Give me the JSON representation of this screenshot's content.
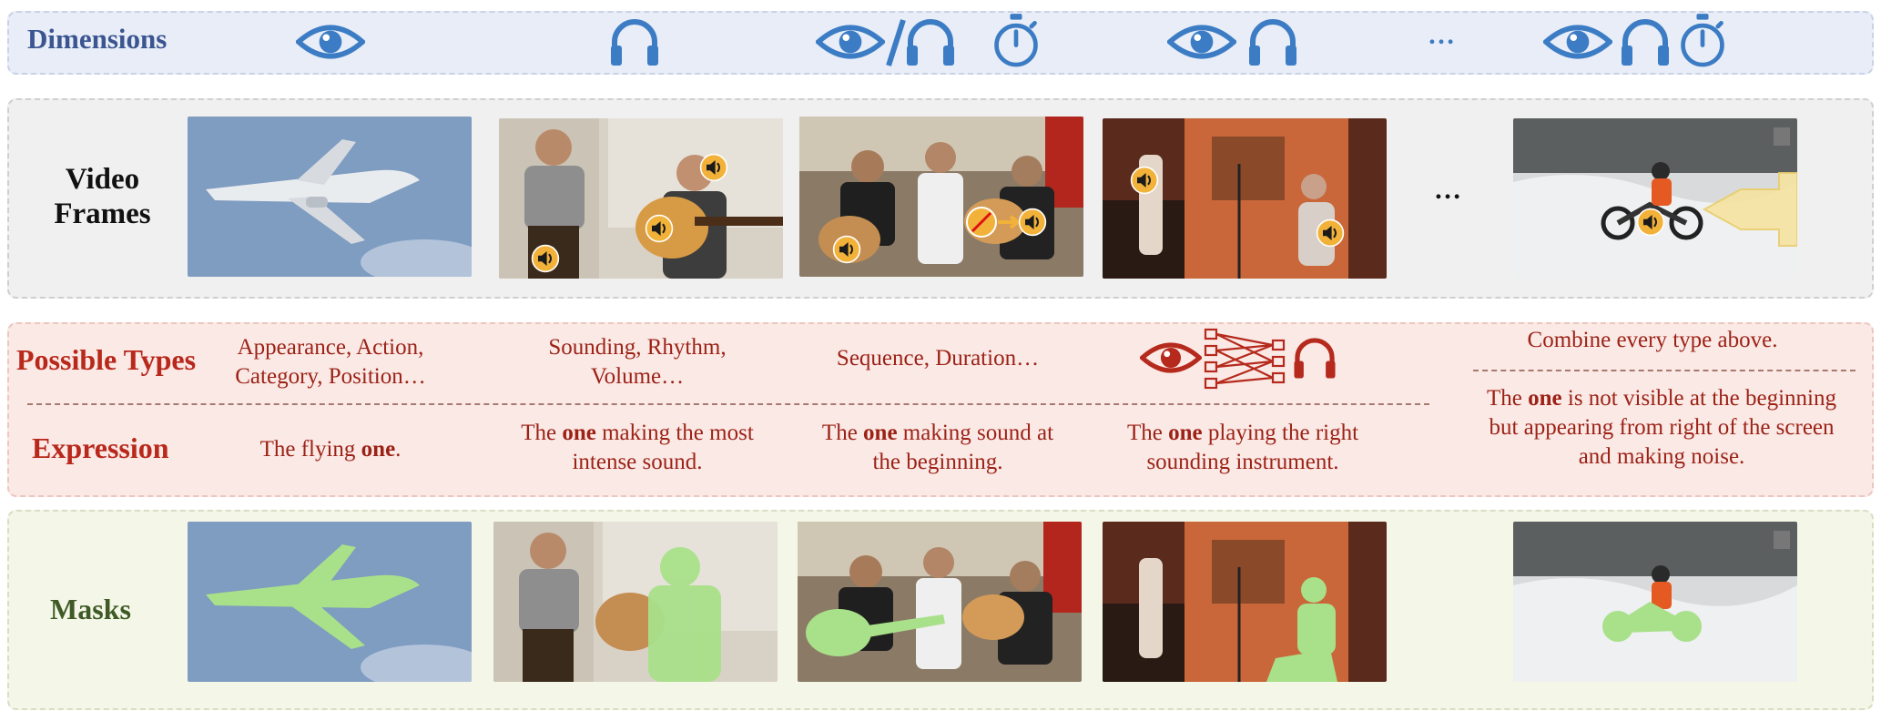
{
  "rows": {
    "dimensions": "Dimensions",
    "video_frames": "Video Frames",
    "possible_types": "Possible Types",
    "expression": "Expression",
    "masks": "Masks"
  },
  "ellipsis": "…",
  "dimension_icons": [
    [
      "eye-icon"
    ],
    [
      "headphones-icon"
    ],
    [
      "eye-icon",
      "headphones-icon",
      "stopwatch-icon"
    ],
    [
      "eye-icon",
      "headphones-icon"
    ],
    [
      "eye-icon",
      "headphones-icon",
      "stopwatch-icon"
    ]
  ],
  "types": {
    "t1_line1": "Appearance, Action,",
    "t1_line2": "Category, Position…",
    "t2_line1": "Sounding, Rhythm,",
    "t2_line2": "Volume…",
    "t3": "Sequence, Duration…",
    "t5": "Combine every type above."
  },
  "expressions": {
    "e1_pre": "The flying ",
    "e1_bold": "one",
    "e1_post": ".",
    "e2_pre": "The ",
    "e2_bold": "one",
    "e2_post1": " making the most",
    "e2_line2": "intense sound.",
    "e3_pre": "The ",
    "e3_bold": "one",
    "e3_post1": " making sound at",
    "e3_line2": "the beginning.",
    "e4_pre": "The ",
    "e4_bold": "one",
    "e4_post1": " playing the right",
    "e4_line2": "sounding instrument.",
    "e5_pre": "The ",
    "e5_bold": "one",
    "e5_post1": " is not visible at the beginning",
    "e5_line2": "but appearing from right of the screen",
    "e5_line3": "and making noise."
  },
  "colors": {
    "dimension_icon": "#3c7cc4",
    "types_icon": "#b52a1c",
    "label_dimensions": "#3b5591",
    "label_types": "#b8281b",
    "label_masks": "#3f5a26",
    "mask_fill": "#a9e08a",
    "sound_badge": "#f2b23a"
  }
}
